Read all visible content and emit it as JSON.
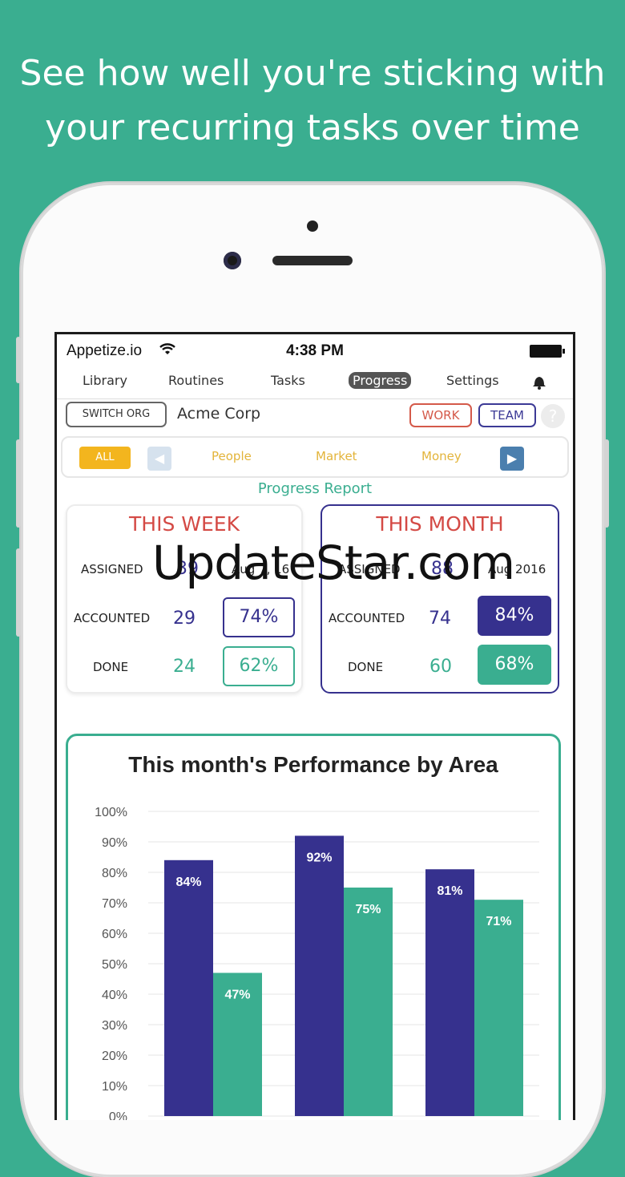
{
  "headline": {
    "line1": "See how well you're sticking with",
    "line2": "your recurring tasks over time"
  },
  "status": {
    "carrier": "Appetize.io",
    "time": "4:38 PM"
  },
  "nav": {
    "library": "Library",
    "routines": "Routines",
    "tasks": "Tasks",
    "progress": "Progress",
    "settings": "Settings"
  },
  "org": {
    "switch_label": "SWITCH ORG",
    "name": "Acme Corp",
    "work_label": "WORK",
    "team_label": "TEAM",
    "help_label": "?"
  },
  "filters": {
    "all_label": "ALL",
    "people": "People",
    "market": "Market",
    "money": "Money"
  },
  "report": {
    "title": "Progress Report"
  },
  "week": {
    "title": "THIS WEEK",
    "assigned_label": "ASSIGNED",
    "assigned": "39",
    "date": "Aug 7, 16",
    "accounted_label": "ACCOUNTED",
    "accounted": "29",
    "accounted_pct": "74%",
    "done_label": "DONE",
    "done": "24",
    "done_pct": "62%"
  },
  "month": {
    "title": "THIS MONTH",
    "assigned_label": "ASSIGNED",
    "assigned": "88",
    "date": "Aug 2016",
    "accounted_label": "ACCOUNTED",
    "accounted": "74",
    "accounted_pct": "84%",
    "done_label": "DONE",
    "done": "60",
    "done_pct": "68%"
  },
  "watermark": "UpdateStar.com",
  "colors": {
    "teal": "#3aae90",
    "indigo": "#36318e",
    "red": "#d44a45",
    "yellow": "#f3b51e"
  },
  "icons": {
    "wifi": "wifi-icon",
    "battery": "battery-icon",
    "bell": "bell-icon",
    "prev": "left-arrow-icon",
    "next": "right-arrow-icon"
  },
  "chart_data": {
    "type": "bar",
    "title": "This month's Performance by Area",
    "categories": [
      "",
      "",
      ""
    ],
    "series": [
      {
        "values": [
          84,
          92,
          81
        ],
        "color": "#36318e"
      },
      {
        "values": [
          47,
          75,
          71
        ],
        "color": "#3aae90"
      }
    ],
    "data_labels": [
      [
        "84%",
        "92%",
        "81%"
      ],
      [
        "47%",
        "75%",
        "71%"
      ]
    ],
    "ylim": [
      0,
      100
    ],
    "yticks": [
      "0%",
      "10%",
      "20%",
      "30%",
      "40%",
      "50%",
      "60%",
      "70%",
      "80%",
      "90%",
      "100%"
    ],
    "grid": true,
    "legend": "none"
  }
}
